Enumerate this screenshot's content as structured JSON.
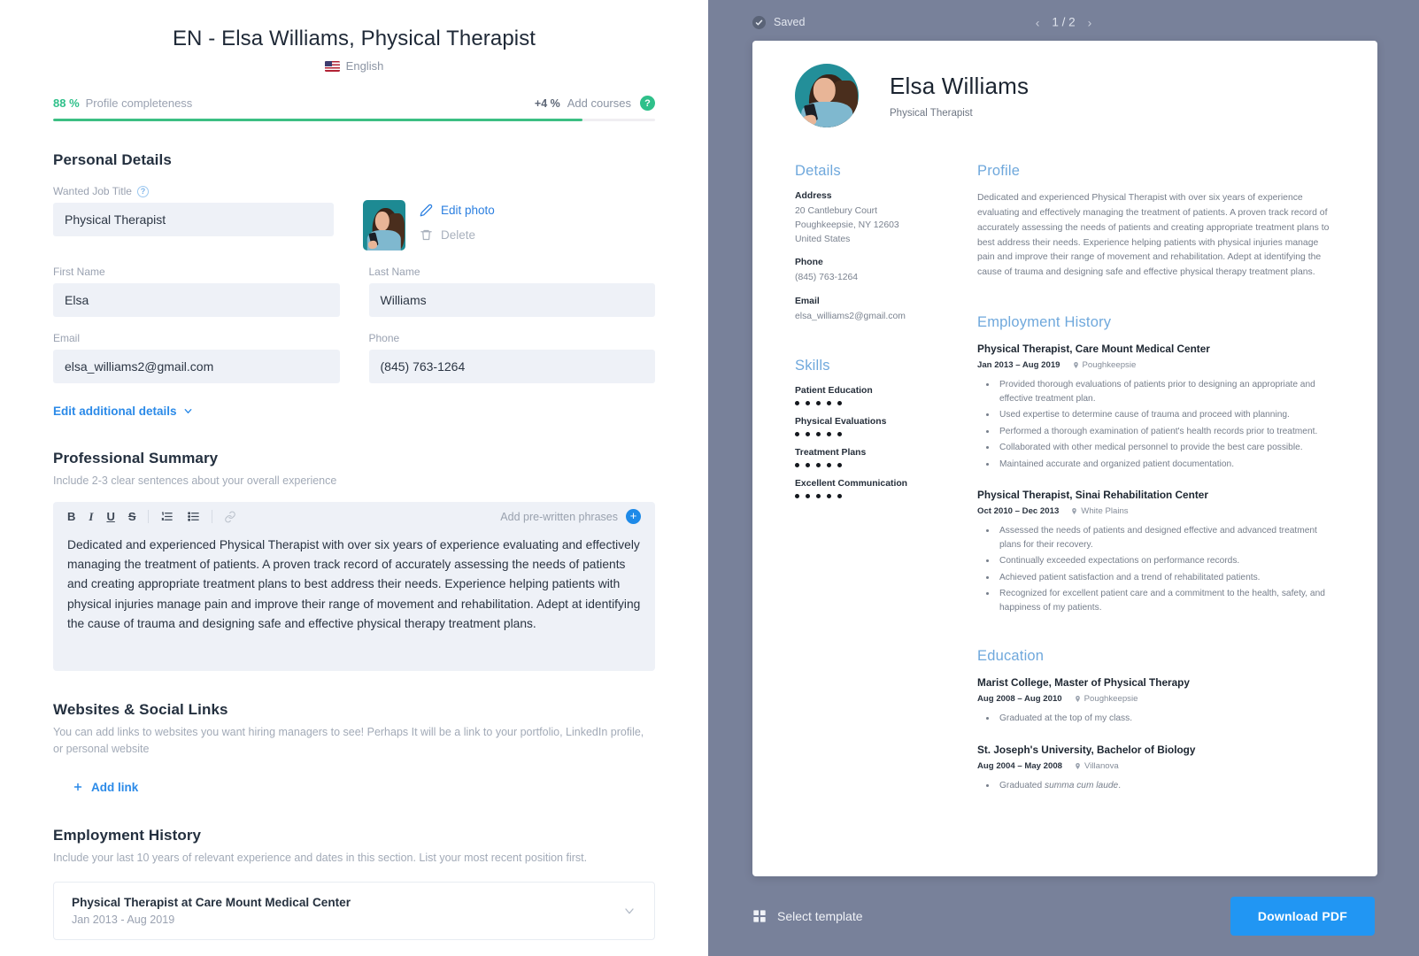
{
  "editor": {
    "doc_title": "EN - Elsa Williams, Physical Therapist",
    "language": "English",
    "progress": {
      "percent_label": "88 %",
      "percent_value": 88,
      "label": "Profile completeness",
      "add_percent": "+4 %",
      "add_label": "Add courses",
      "help_icon": "?"
    },
    "personal_details": {
      "title": "Personal Details",
      "job_title_label": "Wanted Job Title",
      "job_title_value": "Physical Therapist",
      "first_name_label": "First Name",
      "first_name_value": "Elsa",
      "last_name_label": "Last Name",
      "last_name_value": "Williams",
      "email_label": "Email",
      "email_value": "elsa_williams2@gmail.com",
      "phone_label": "Phone",
      "phone_value": "(845) 763-1264",
      "edit_photo": "Edit photo",
      "delete_photo": "Delete",
      "edit_additional": "Edit additional details"
    },
    "professional_summary": {
      "title": "Professional Summary",
      "subtitle": "Include 2-3 clear sentences about your overall experience",
      "toolbar": {
        "bold": "B",
        "italic": "I",
        "underline": "U",
        "strike": "S",
        "add_phrases": "Add pre-written phrases",
        "plus": "+"
      },
      "body": "Dedicated and experienced Physical Therapist with over six years of experience evaluating and effectively managing the treatment of patients. A proven track record of accurately assessing the needs of patients and creating appropriate treatment plans to best address their needs. Experience helping patients with physical injuries manage pain and improve their range of movement and rehabilitation. Adept at identifying the cause of trauma and designing safe and effective physical therapy treatment plans."
    },
    "websites": {
      "title": "Websites & Social Links",
      "subtitle": "You can add links to websites you want hiring managers to see! Perhaps It will be a link to your portfolio, LinkedIn profile, or personal website",
      "add_link": "Add link"
    },
    "employment": {
      "title": "Employment History",
      "subtitle": "Include your last 10 years of relevant experience and dates in this section. List your most recent position first.",
      "items": [
        {
          "title": "Physical Therapist at Care Mount Medical Center",
          "date": "Jan 2013 - Aug 2019"
        }
      ]
    }
  },
  "preview": {
    "saved_label": "Saved",
    "page_indicator": "1 / 2",
    "prev_arrow": "‹",
    "next_arrow": "›",
    "select_template": "Select template",
    "download_pdf": "Download PDF",
    "resume": {
      "name": "Elsa Williams",
      "role": "Physical Therapist",
      "details": {
        "heading": "Details",
        "address_label": "Address",
        "address_lines": "20 Cantlebury Court\nPoughkeepsie, NY 12603\nUnited States",
        "phone_label": "Phone",
        "phone_value": "(845) 763-1264",
        "email_label": "Email",
        "email_value": "elsa_williams2@gmail.com"
      },
      "skills": {
        "heading": "Skills",
        "items": [
          {
            "name": "Patient Education",
            "level": 5
          },
          {
            "name": "Physical Evaluations",
            "level": 5
          },
          {
            "name": "Treatment Plans",
            "level": 5
          },
          {
            "name": "Excellent Communication",
            "level": 5
          }
        ],
        "max_level": 5
      },
      "profile": {
        "heading": "Profile",
        "text": "Dedicated and experienced Physical Therapist with over six years of experience evaluating and effectively managing the treatment of patients. A proven track record of accurately assessing the needs of patients and creating appropriate treatment plans to best address their needs. Experience helping patients with physical injuries manage pain and improve their range of movement and rehabilitation. Adept at identifying the cause of trauma and designing safe and effective physical therapy treatment plans."
      },
      "employment": {
        "heading": "Employment History",
        "items": [
          {
            "title": "Physical Therapist, Care Mount Medical Center",
            "date": "Jan 2013 – Aug 2019",
            "location": "Poughkeepsie",
            "bullets": [
              "Provided thorough evaluations of patients prior to designing an appropriate and effective treatment plan.",
              "Used expertise to determine cause of trauma and proceed with planning.",
              "Performed a thorough examination of patient's health records prior to treatment.",
              "Collaborated with other medical personnel to provide the best care possible.",
              "Maintained accurate and organized patient documentation."
            ]
          },
          {
            "title": "Physical Therapist, Sinai Rehabilitation Center",
            "date": "Oct 2010 – Dec 2013",
            "location": "White Plains",
            "bullets": [
              "Assessed the needs of patients and designed effective and advanced treatment plans for their recovery.",
              "Continually exceeded expectations on performance records.",
              "Achieved patient satisfaction and a trend of rehabilitated patients.",
              "Recognized for excellent patient care and a commitment to the health, safety, and happiness of my patients."
            ]
          }
        ]
      },
      "education": {
        "heading": "Education",
        "items": [
          {
            "title": "Marist College, Master of Physical Therapy",
            "date": "Aug 2008 – Aug 2010",
            "location": "Poughkeepsie",
            "bullets": [
              "Graduated at the top of my class."
            ]
          },
          {
            "title": "St. Joseph's University, Bachelor of Biology",
            "date": "Aug 2004 – May 2008",
            "location": "Villanova",
            "bullets": [
              "Graduated summa cum laude."
            ]
          }
        ]
      }
    }
  },
  "colors": {
    "accent_blue": "#2196f3",
    "progress_green": "#3cbf83",
    "preview_bg": "#78819a",
    "resume_heading": "#6fa8dc",
    "input_bg": "#eef1f7"
  }
}
